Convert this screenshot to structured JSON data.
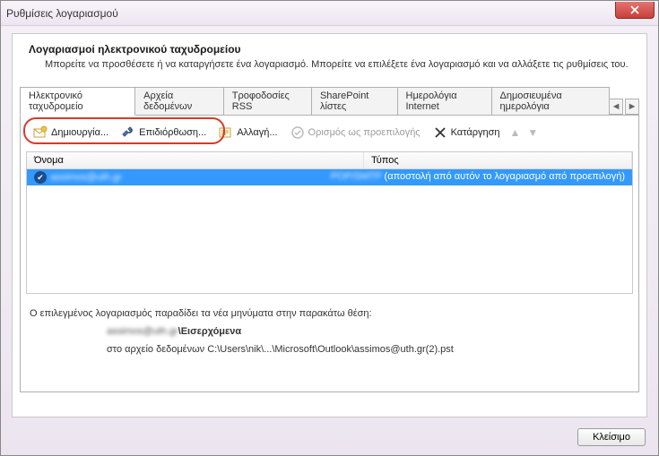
{
  "window": {
    "title": "Ρυθμίσεις λογαριασμού"
  },
  "heading": {
    "title": "Λογαριασμοί ηλεκτρονικού ταχυδρομείου",
    "subtitle": "Μπορείτε να προσθέσετε ή να καταργήσετε ένα λογαριασμό. Μπορείτε να επιλέξετε ένα λογαριασμό και να αλλάξετε τις ρυθμίσεις του."
  },
  "tabs": {
    "items": [
      {
        "label": "Ηλεκτρονικό ταχυδρομείο",
        "active": true
      },
      {
        "label": "Αρχεία δεδομένων"
      },
      {
        "label": "Τροφοδοσίες RSS"
      },
      {
        "label": "SharePoint λίστες"
      },
      {
        "label": "Ημερολόγια Internet"
      },
      {
        "label": "Δημοσιευμένα ημερολόγια"
      }
    ],
    "scroll_left": "◄",
    "scroll_right": "►"
  },
  "toolbar": {
    "new": "Δημιουργία...",
    "repair": "Επιδιόρθωση...",
    "change": "Αλλαγή...",
    "set_default": "Ορισμός ως προεπιλογής",
    "remove": "Κατάργηση"
  },
  "list": {
    "col_name": "Όνομα",
    "col_type": "Τύπος",
    "row": {
      "name": "assimos@uth.gr",
      "type_prefix": "POP/SMTP ",
      "type_suffix": "(αποστολή από αυτόν το λογαριασμό από προεπιλογή)"
    }
  },
  "delivery": {
    "label": "Ο επιλεγμένος λογαριασμός παραδίδει τα νέα μηνύματα στην παρακάτω θέση:",
    "inbox_prefix": "assimos@uth.gr",
    "inbox_bold": "\\Εισερχόμενα",
    "path": "στο αρχείο δεδομένων C:\\Users\\nik\\...\\Microsoft\\Outlook\\assimos@uth.gr(2).pst"
  },
  "footer": {
    "close": "Κλείσιμο"
  }
}
